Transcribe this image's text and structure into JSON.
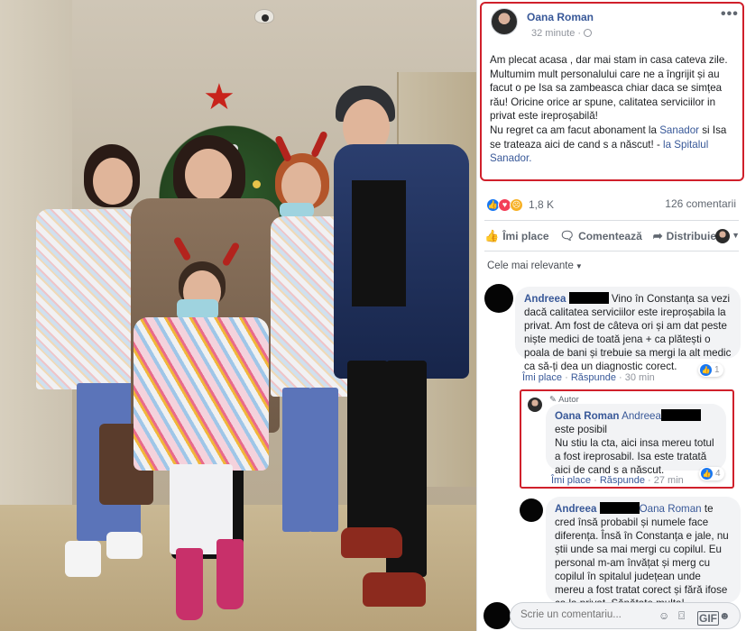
{
  "post": {
    "author": "Oana Roman",
    "time": "32 minute",
    "privacy_icon": "globe-icon",
    "more_icon": "•••",
    "text_parts": {
      "p1": "Am plecat acasa , dar mai stam in casa cateva zile. Multumim mult personalului care ne a îngrijit și au facut o pe Isa sa zambeasca chiar daca se simțea rău! Oricine orice ar spune, calitatea serviciilor in privat este ireproșabilă!",
      "p2_pre": "Nu regret ca am facut abonament la ",
      "p2_link1": "Sanador",
      "p2_mid": " si Isa se trateaza aici de cand s a născut! - ",
      "p2_link2": "la Spitalul Sanador."
    }
  },
  "stats": {
    "reactions_count": "1,8 K",
    "comments_count": "126 comentarii"
  },
  "actions": {
    "like": "Îmi place",
    "comment": "Comentează",
    "share": "Distribuie"
  },
  "sort_label": "Cele mai relevante",
  "comments": [
    {
      "name": "Andreea",
      "text": "Vino în Constanța sa vezi dacă calitatea serviciilor este ireproșabila la privat. Am fost de câteva ori și am dat peste niște medici de toată jena + ca plătești o poala de bani și trebuie sa mergi la alt medic ca să-ți dea un diagnostic corect.",
      "like": "Îmi place",
      "reply": "Răspunde",
      "time": "30 min",
      "likes": "1"
    },
    {
      "tag": "Autor",
      "name": "Oana Roman",
      "mention": "Andreea",
      "text_after_mention": "este posibil",
      "text": "Nu stiu la cta, aici insa mereu totul a fost ireprosabil. Isa este tratată aici de cand s a născut.",
      "like": "Îmi place",
      "reply": "Răspunde",
      "time": "27 min",
      "likes": "4"
    },
    {
      "name": "Andreea",
      "mention": "Oana Roman",
      "text_after_mention": "te cred însă probabil și numele face diferența. Însă în Constanța e jale, nu știi unde sa mai mergi cu copilul. Eu personal m-am învățat și merg cu copilul în spitalul județean unde mereu a fost tratat corect și fără ifose ca la privat. Sănătate multa!"
    }
  ],
  "composer": {
    "placeholder": "Scrie un comentariu..."
  },
  "colors": {
    "link": "#385898",
    "highlight": "#d0202b",
    "like_blue": "#1877f2"
  }
}
